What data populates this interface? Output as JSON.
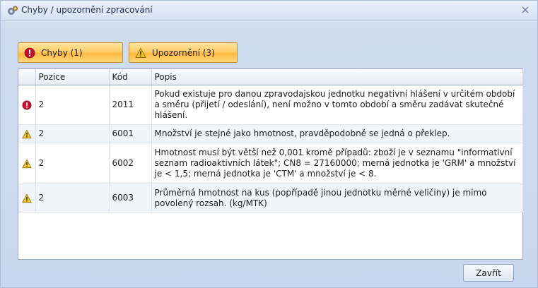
{
  "window": {
    "title": "Chyby / upozornění zpracování",
    "close_label": "X"
  },
  "tabs": [
    {
      "label": "Chyby (1)",
      "icon": "error-icon"
    },
    {
      "label": "Upozornění (3)",
      "icon": "warning-icon"
    }
  ],
  "grid": {
    "columns": [
      "",
      "Pozice",
      "Kód",
      "Popis"
    ],
    "rows": [
      {
        "icon": "error-icon",
        "position": "2",
        "code": "2011",
        "description": "Pokud existuje pro danou zpravodajskou jednotku negativní hlášení v určitém období a směru (přijetí / odeslání), není možno v tomto období a směru zadávat skutečné hlášení."
      },
      {
        "icon": "warning-icon",
        "position": "2",
        "code": "6001",
        "description": "Množství je stejné jako hmotnost, pravděpodobně se jedná o překlep."
      },
      {
        "icon": "warning-icon",
        "position": "2",
        "code": "6002",
        "description": "Hmotnost musí být větší než 0,001 kromě případů: zboží je v seznamu \"informativní seznam radioaktivních látek\"; CN8 = 27160000; merná jednotka je 'GRM' a množství je < 1,5; merná jednotka je 'CTM' a množství je < 8."
      },
      {
        "icon": "warning-icon",
        "position": "2",
        "code": "6003",
        "description": "Průměrná hmotnost na kus (popřípadě jinou jednotku měrné veličiny) je mimo povolený rozsah. (kg/MTK)"
      }
    ]
  },
  "footer": {
    "close_button": "Zavřít"
  }
}
